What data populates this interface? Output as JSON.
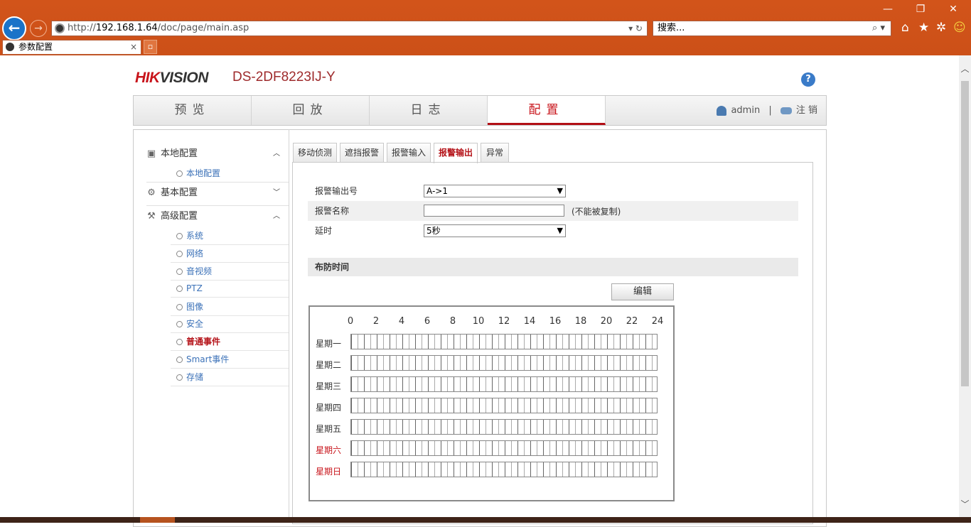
{
  "browser": {
    "url_prefix": "http://",
    "url_host": "192.168.1.64",
    "url_path": "/doc/page/main.asp",
    "search_placeholder": "搜索...",
    "tab_title": "参数配置"
  },
  "header": {
    "logo_red": "HIK",
    "logo_dark": "VISION",
    "model": "DS-2DF8223IJ-Y",
    "help": "?"
  },
  "nav": {
    "items": [
      "预览",
      "回放",
      "日志",
      "配置"
    ],
    "active": "配置",
    "user": "admin",
    "sep": "|",
    "logout": "注 销"
  },
  "sidebar": {
    "local": {
      "label": "本地配置",
      "items": [
        "本地配置"
      ]
    },
    "basic": {
      "label": "基本配置"
    },
    "advanced": {
      "label": "高级配置",
      "items": [
        "系统",
        "网络",
        "音视频",
        "PTZ",
        "图像",
        "安全",
        "普通事件",
        "Smart事件",
        "存储"
      ]
    },
    "active_item": "普通事件"
  },
  "tabs": [
    "移动侦测",
    "遮挡报警",
    "报警输入",
    "报警输出",
    "异常"
  ],
  "active_tab": "报警输出",
  "form": {
    "output_label": "报警输出号",
    "output_value": "A->1",
    "name_label": "报警名称",
    "name_value": "",
    "name_note": "(不能被复制)",
    "delay_label": "延时",
    "delay_value": "5秒"
  },
  "schedule": {
    "title": "布防时间",
    "edit_button": "编辑",
    "hours": [
      "0",
      "2",
      "4",
      "6",
      "8",
      "10",
      "12",
      "14",
      "16",
      "18",
      "20",
      "22",
      "24"
    ],
    "days": [
      "星期一",
      "星期二",
      "星期三",
      "星期四",
      "星期五",
      "星期六",
      "星期日"
    ],
    "weekend_color": "#c8141b"
  },
  "colors": {
    "brand_red": "#c8141b",
    "chrome_orange": "#d2541a",
    "link_blue": "#3c72b8"
  }
}
